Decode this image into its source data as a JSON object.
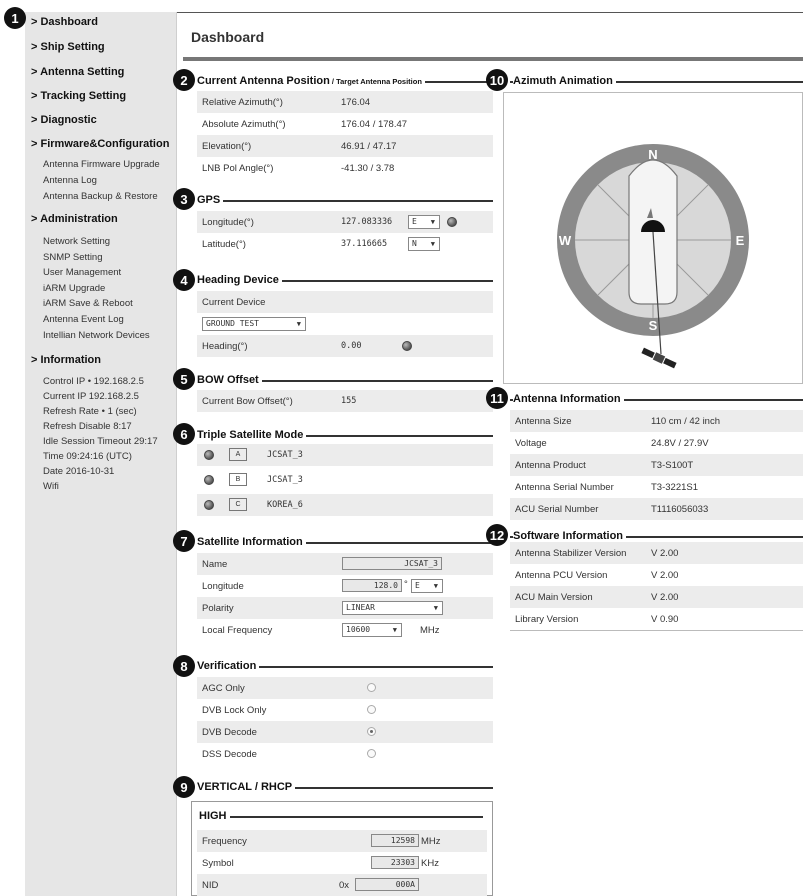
{
  "callouts": [
    "1",
    "2",
    "3",
    "4",
    "5",
    "6",
    "7",
    "8",
    "9",
    "10",
    "11",
    "12"
  ],
  "sidebar": {
    "dashboard": "> Dashboard",
    "ship_setting": "> Ship Setting",
    "antenna_setting": "> Antenna Setting",
    "tracking_setting": "> Tracking Setting",
    "diagnostic": "> Diagnostic",
    "firmware": "> Firmware&Configuration",
    "firmware_items": [
      "Antenna Firmware Upgrade",
      "Antenna Log",
      "Antenna Backup & Restore"
    ],
    "administration": "> Administration",
    "admin_items": [
      "Network Setting",
      "SNMP Setting",
      "User Management",
      "iARM Upgrade",
      "iARM Save & Reboot",
      "Antenna Event Log",
      "Intellian Network Devices"
    ],
    "information": "> Information",
    "info_items": [
      "Control IP • 192.168.2.5",
      "Current IP  192.168.2.5",
      "Refresh Rate •   1 (sec)",
      "Refresh Disable  8:17",
      "Idle Session Timeout  29:17",
      "Time  09:24:16 (UTC)",
      "Date  2016-10-31",
      "Wifi"
    ]
  },
  "page_title": "Dashboard",
  "antenna_position": {
    "title": "Current Antenna Position",
    "title_suffix": " / Target Antenna Position",
    "rows": [
      {
        "label": "Relative Azimuth(°)",
        "value": "176.04"
      },
      {
        "label": "Absolute Azimuth(°)",
        "value": "176.04 / 178.47"
      },
      {
        "label": "Elevation(°)",
        "value": "46.91 / 47.17"
      },
      {
        "label": "LNB Pol Angle(°)",
        "value": "-41.30 / 3.78"
      }
    ]
  },
  "gps": {
    "title": "GPS",
    "longitude_label": "Longitude(°)",
    "longitude_value": "127.083336",
    "longitude_dir": "E",
    "latitude_label": "Latitude(°)",
    "latitude_value": "37.116665",
    "latitude_dir": "N"
  },
  "heading": {
    "title": "Heading Device",
    "current_device_label": "Current Device",
    "device_value": "GROUND TEST",
    "heading_label": "Heading(°)",
    "heading_value": "0.00"
  },
  "bow": {
    "title": "BOW Offset",
    "label": "Current Bow Offset(°)",
    "value": "155"
  },
  "triple": {
    "title": "Triple Satellite Mode",
    "items": [
      {
        "slot": "A",
        "name": "JCSAT_3"
      },
      {
        "slot": "B",
        "name": "JCSAT_3"
      },
      {
        "slot": "C",
        "name": "KOREA_6"
      }
    ]
  },
  "sat_info": {
    "title": "Satellite Information",
    "name_label": "Name",
    "name_value": "JCSAT_3",
    "lon_label": "Longitude",
    "lon_value": "128.0",
    "lon_unit": "°",
    "lon_dir": "E",
    "pol_label": "Polarity",
    "pol_value": "LINEAR",
    "freq_label": "Local Frequency",
    "freq_value": "10600",
    "freq_unit": "MHz"
  },
  "verification": {
    "title": "Verification",
    "options": [
      {
        "label": "AGC Only",
        "selected": false
      },
      {
        "label": "DVB Lock Only",
        "selected": false
      },
      {
        "label": "DVB Decode",
        "selected": true
      },
      {
        "label": "DSS Decode",
        "selected": false
      }
    ]
  },
  "vrhcp": {
    "title": "VERTICAL / RHCP",
    "sub_title": "HIGH",
    "freq_label": "Frequency",
    "freq_value": "12598",
    "freq_unit": "MHz",
    "symbol_label": "Symbol",
    "symbol_value": "23303",
    "symbol_unit": "KHz",
    "nid_label": "NID",
    "nid_prefix": "0x",
    "nid_value": "000A"
  },
  "azimuth": {
    "title": "Azimuth Animation",
    "n": "N",
    "s": "S",
    "e": "E",
    "w": "W"
  },
  "antenna_info": {
    "title": "Antenna Information",
    "rows": [
      {
        "label": "Antenna Size",
        "value": "110 cm / 42 inch"
      },
      {
        "label": "Voltage",
        "value": "24.8V / 27.9V"
      },
      {
        "label": "Antenna Product",
        "value": "T3-S100T"
      },
      {
        "label": "Antenna Serial Number",
        "value": "T3-3221S1"
      },
      {
        "label": "ACU Serial Number",
        "value": "T1116056033"
      }
    ]
  },
  "software_info": {
    "title": "Software Information",
    "rows": [
      {
        "label": "Antenna Stabilizer Version",
        "value": "V 2.00"
      },
      {
        "label": "Antenna PCU Version",
        "value": "V 2.00"
      },
      {
        "label": "ACU Main Version",
        "value": "V 2.00"
      },
      {
        "label": "Library Version",
        "value": "V 0.90"
      }
    ]
  },
  "colors": {
    "sidebar_bg": "#e6e6e6",
    "row_shade": "#ececec",
    "callout": "#111111"
  }
}
